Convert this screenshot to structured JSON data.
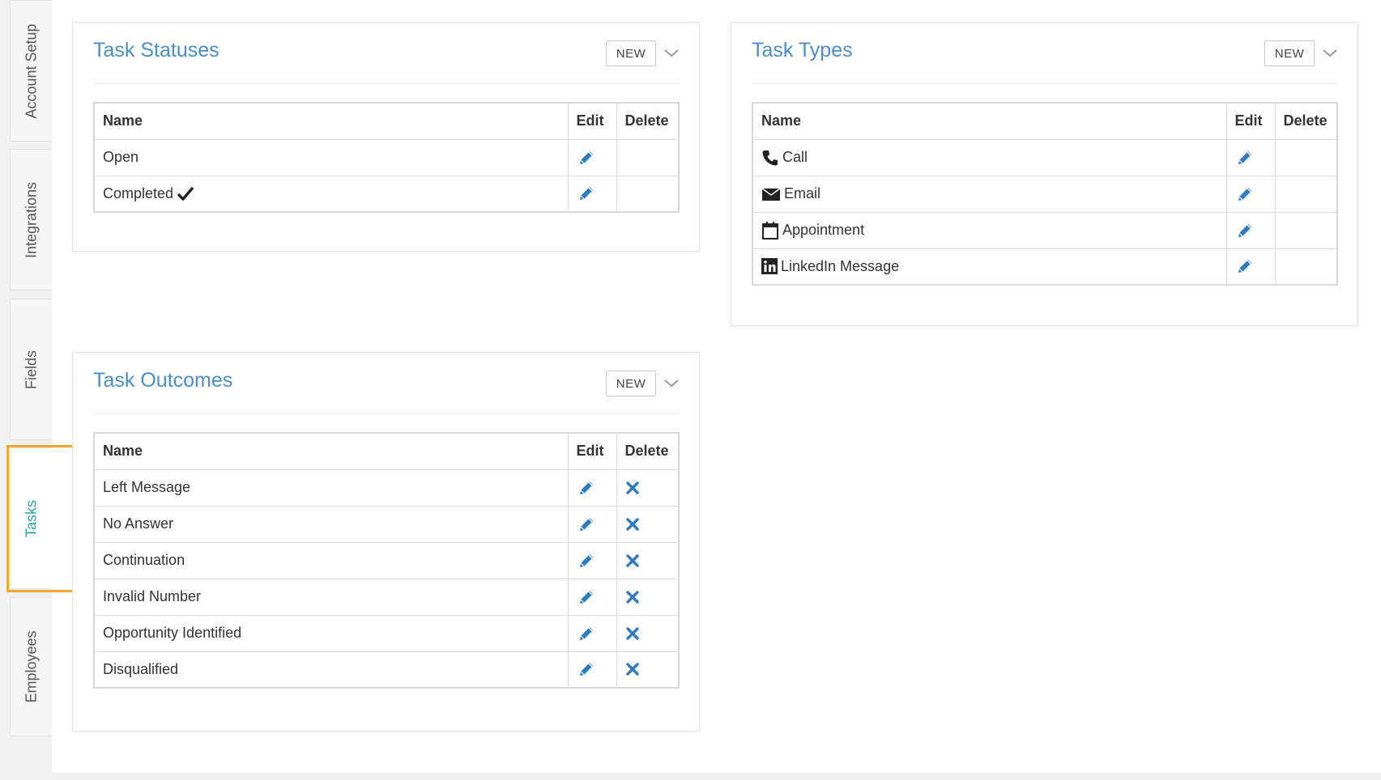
{
  "sidebar": {
    "tabs": [
      {
        "label": "Account Setup"
      },
      {
        "label": "Integrations"
      },
      {
        "label": "Fields"
      },
      {
        "label": "Tasks"
      },
      {
        "label": "Employees"
      }
    ],
    "active": "Tasks"
  },
  "task_statuses": {
    "title": "Task Statuses",
    "new_label": "NEW",
    "headers": {
      "name": "Name",
      "edit": "Edit",
      "delete": "Delete"
    },
    "rows": [
      {
        "name": "Open",
        "icon": null,
        "suffix_icon": null,
        "deletable": false
      },
      {
        "name": "Completed",
        "icon": null,
        "suffix_icon": "checkmark-icon",
        "deletable": false
      }
    ]
  },
  "task_types": {
    "title": "Task Types",
    "new_label": "NEW",
    "headers": {
      "name": "Name",
      "edit": "Edit",
      "delete": "Delete"
    },
    "rows": [
      {
        "name": "Call",
        "icon": "phone-icon",
        "deletable": false
      },
      {
        "name": "Email",
        "icon": "envelope-icon",
        "deletable": false
      },
      {
        "name": "Appointment",
        "icon": "calendar-icon",
        "deletable": false
      },
      {
        "name": "LinkedIn Message",
        "icon": "linkedin-icon",
        "deletable": false
      }
    ]
  },
  "task_outcomes": {
    "title": "Task Outcomes",
    "new_label": "NEW",
    "headers": {
      "name": "Name",
      "edit": "Edit",
      "delete": "Delete"
    },
    "rows": [
      {
        "name": "Left Message",
        "deletable": true
      },
      {
        "name": "No Answer",
        "deletable": true
      },
      {
        "name": "Continuation",
        "deletable": true
      },
      {
        "name": "Invalid Number",
        "deletable": true
      },
      {
        "name": "Opportunity Identified",
        "deletable": true
      },
      {
        "name": "Disqualified",
        "deletable": true
      }
    ]
  },
  "colors": {
    "accent_title": "#4b8ec7",
    "active_tab": "#26a69a",
    "highlight": "#f0a830",
    "edit_icon": "#2f7bbf",
    "delete_icon": "#2f7bbf"
  }
}
